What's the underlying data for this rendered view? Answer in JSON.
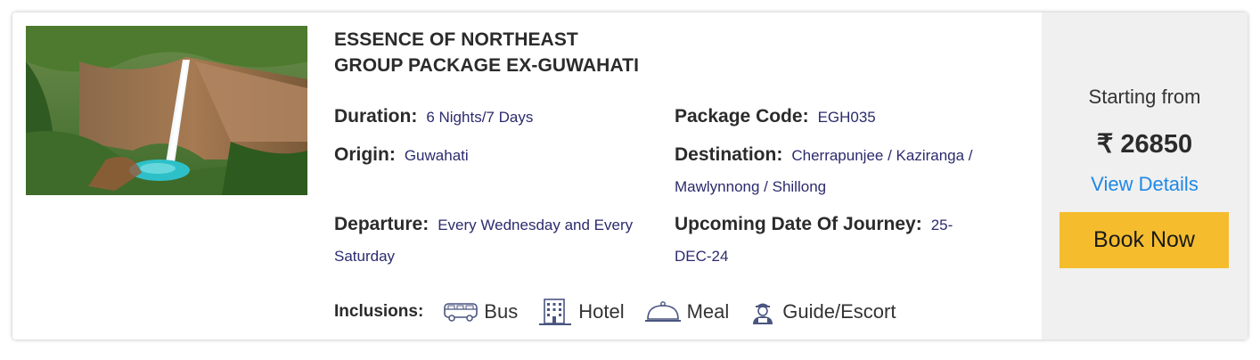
{
  "package": {
    "title_line1": "ESSENCE OF NORTHEAST",
    "title_line2": "GROUP PACKAGE EX-GUWAHATI",
    "image_alt": "Waterfall cliff in Meghalaya",
    "details": {
      "duration_label": "Duration:",
      "duration_value": "6 Nights/7 Days",
      "code_label": "Package Code:",
      "code_value": "EGH035",
      "origin_label": "Origin:",
      "origin_value": "Guwahati",
      "destination_label": "Destination:",
      "destination_value": "Cherrapunjee / Kaziranga / Mawlynnong / Shillong",
      "departure_label": "Departure:",
      "departure_value": "Every Wednesday and Every Saturday",
      "journey_label": "Upcoming Date Of Journey:",
      "journey_value": "25-DEC-24"
    },
    "inclusions": {
      "label": "Inclusions:",
      "items": [
        {
          "label": "Bus",
          "icon": "bus-icon"
        },
        {
          "label": "Hotel",
          "icon": "hotel-icon"
        },
        {
          "label": "Meal",
          "icon": "meal-icon"
        },
        {
          "label": "Guide/Escort",
          "icon": "guide-icon"
        }
      ]
    }
  },
  "pricing": {
    "starting_label": "Starting from",
    "price": "₹ 26850",
    "view_details": "View Details",
    "book_now": "Book Now"
  },
  "colors": {
    "accent_button": "#f5bd2e",
    "link": "#1e88e5",
    "value_text": "#2b2b6e",
    "side_bg": "#f0f0f0"
  }
}
